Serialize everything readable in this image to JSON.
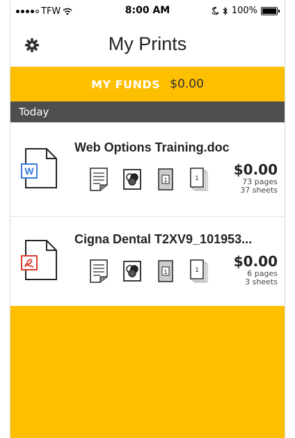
{
  "status_bar": {
    "carrier": "TFW",
    "time": "8:00 AM",
    "battery": "100%"
  },
  "header": {
    "title": "My Prints"
  },
  "funds": {
    "label": "MY FUNDS",
    "amount": "$0.00"
  },
  "section": {
    "label": "Today"
  },
  "items": [
    {
      "name": "Web Options Training.doc",
      "price": "$0.00",
      "pages": "73 pages",
      "sheets": "37 sheets",
      "file_type": "word"
    },
    {
      "name": "Cigna Dental T2XV9_101953...",
      "price": "$0.00",
      "pages": "6 pages",
      "sheets": "3 sheets",
      "file_type": "pdf"
    }
  ],
  "option_labels": {
    "copies": "1"
  },
  "colors": {
    "accent": "#fdbf00",
    "section_bg": "#4e4e4e",
    "word_blue": "#3a7be0",
    "pdf_red": "#e03a2f"
  }
}
